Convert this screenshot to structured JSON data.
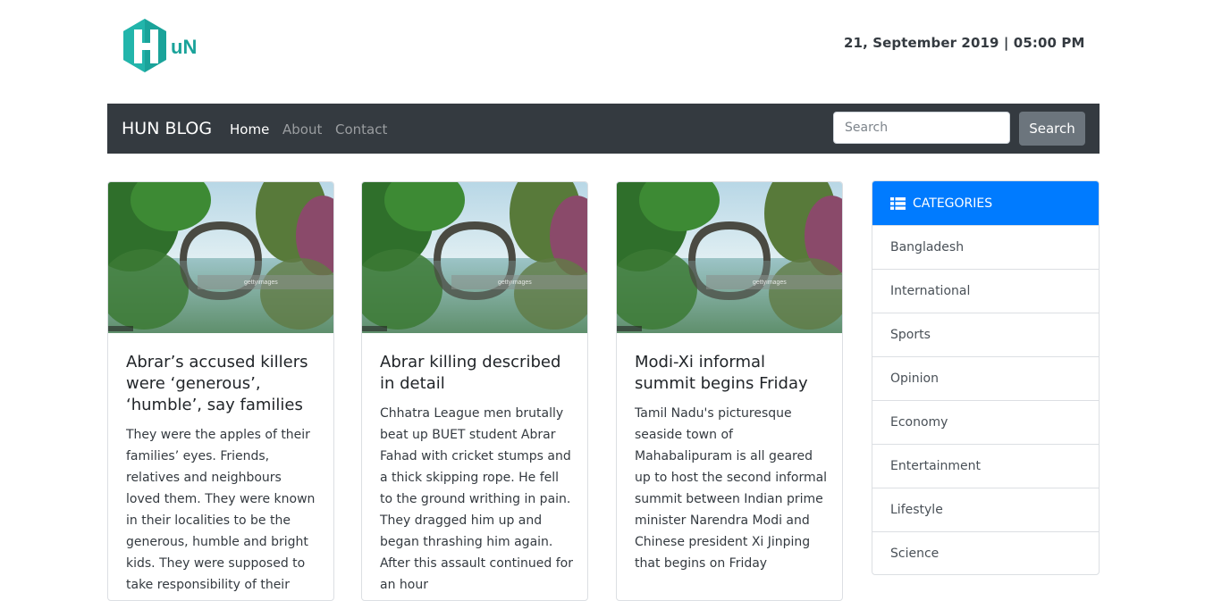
{
  "header": {
    "logo_alt": "HuN",
    "logo_letters": "uN",
    "datetime": "21, September 2019 | 05:00 PM"
  },
  "navbar": {
    "brand": "HUN BLOG",
    "links": [
      "Home",
      "About",
      "Contact"
    ],
    "search_placeholder": "Search",
    "search_button": "Search"
  },
  "posts": [
    {
      "title": "Abrar’s accused killers were ‘generous’, ‘humble’, say families",
      "body": "They were the apples of their families’ eyes. Friends, relatives and neighbours loved them. They were known in their localities to be the generous, humble and bright kids. They were supposed to take responsibility of their"
    },
    {
      "title": "Abrar killing described in detail",
      "body": "Chhatra League men brutally beat up BUET student Abrar Fahad with cricket stumps and a thick skipping rope. He fell to the ground writhing in pain. They dragged him up and began thrashing him again. After this assault continued for an hour"
    },
    {
      "title": "Modi-Xi informal summit begins Friday",
      "body": "Tamil Nadu's picturesque seaside town of Mahabalipuram is all geared up to host the second informal summit between Indian prime minister Narendra Modi and Chinese president Xi Jinping that begins on Friday"
    }
  ],
  "categories": {
    "title": "CATEGORIES",
    "items": [
      "Bangladesh",
      "International",
      "Sports",
      "Opinion",
      "Economy",
      "Entertainment",
      "Lifestyle",
      "Science"
    ]
  },
  "colors": {
    "accent": "#007bff",
    "navbar": "#343a40",
    "logo": "#1aa39a"
  }
}
